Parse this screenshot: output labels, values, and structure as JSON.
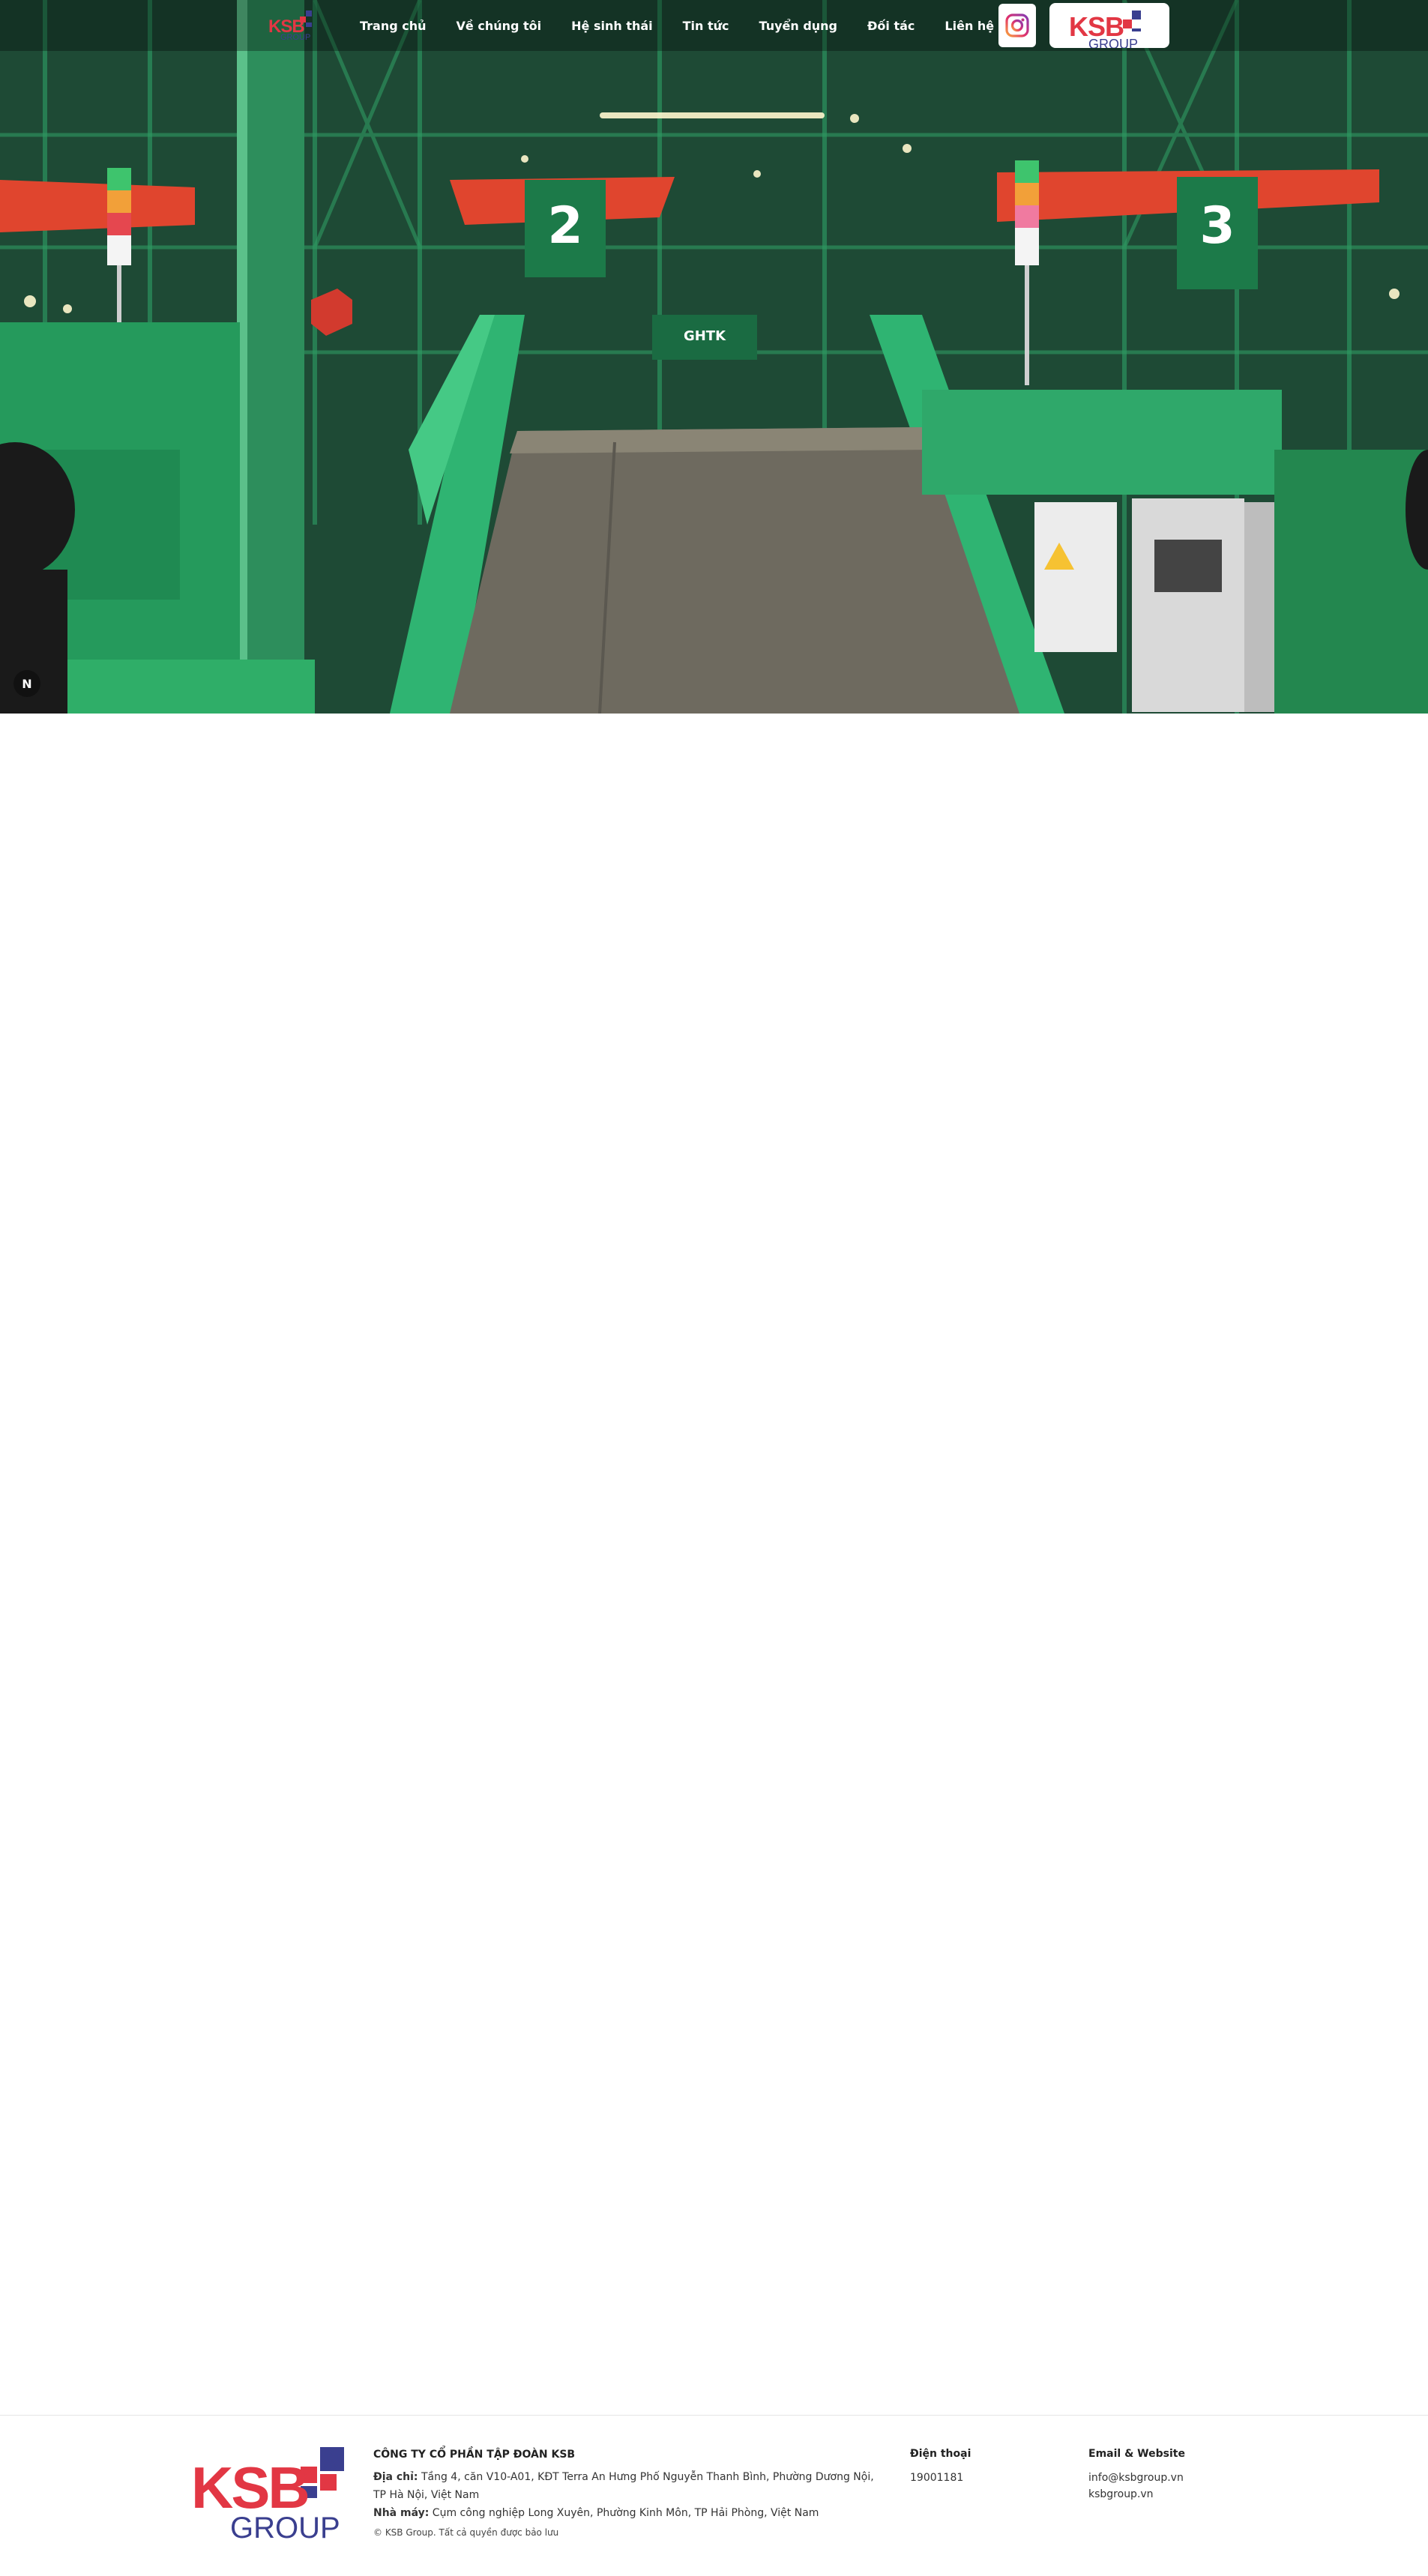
{
  "nav": {
    "logo_text": "KSB",
    "logo_sub": "GROUP",
    "items": [
      {
        "label": "Trang chủ"
      },
      {
        "label": "Về chúng tôi"
      },
      {
        "label": "Hệ sinh thái"
      },
      {
        "label": "Tin tức"
      },
      {
        "label": "Tuyển dụng"
      },
      {
        "label": "Đối tác"
      },
      {
        "label": "Liên hệ"
      }
    ],
    "brand_button_text": "KSB",
    "brand_button_sub": "GROUP"
  },
  "hero": {
    "sign_left": "2",
    "sign_right": "3",
    "banner_text": "GHTK",
    "badge": "N"
  },
  "footer": {
    "logo_text": "KSB",
    "logo_sub": "GROUP",
    "company_name": "CÔNG TY CỔ PHẦN TẬP ĐOÀN KSB",
    "address_label": "Địa chỉ:",
    "address": "Tầng 4, căn V10-A01, KĐT Terra An Hưng Phố Nguyễn Thanh Bình, Phường Dương Nội, TP Hà Nội, Việt Nam",
    "factory_label": "Nhà máy:",
    "factory": "Cụm công nghiệp Long Xuyên, Phường Kinh Môn, TP Hải Phòng, Việt Nam",
    "copyright": "© KSB Group. Tất cả quyền được bảo lưu",
    "phone_heading": "Điện thoại",
    "phone": "19001181",
    "email_heading": "Email & Website",
    "email": "info@ksbgroup.vn",
    "website": "ksbgroup.vn"
  },
  "colors": {
    "brand_red": "#e23744",
    "brand_blue": "#3a3f8f",
    "warehouse_green": "#1f9a5a",
    "shelf_orange": "#e0452e"
  },
  "icons": [
    "instagram-icon",
    "ksb-logo"
  ]
}
